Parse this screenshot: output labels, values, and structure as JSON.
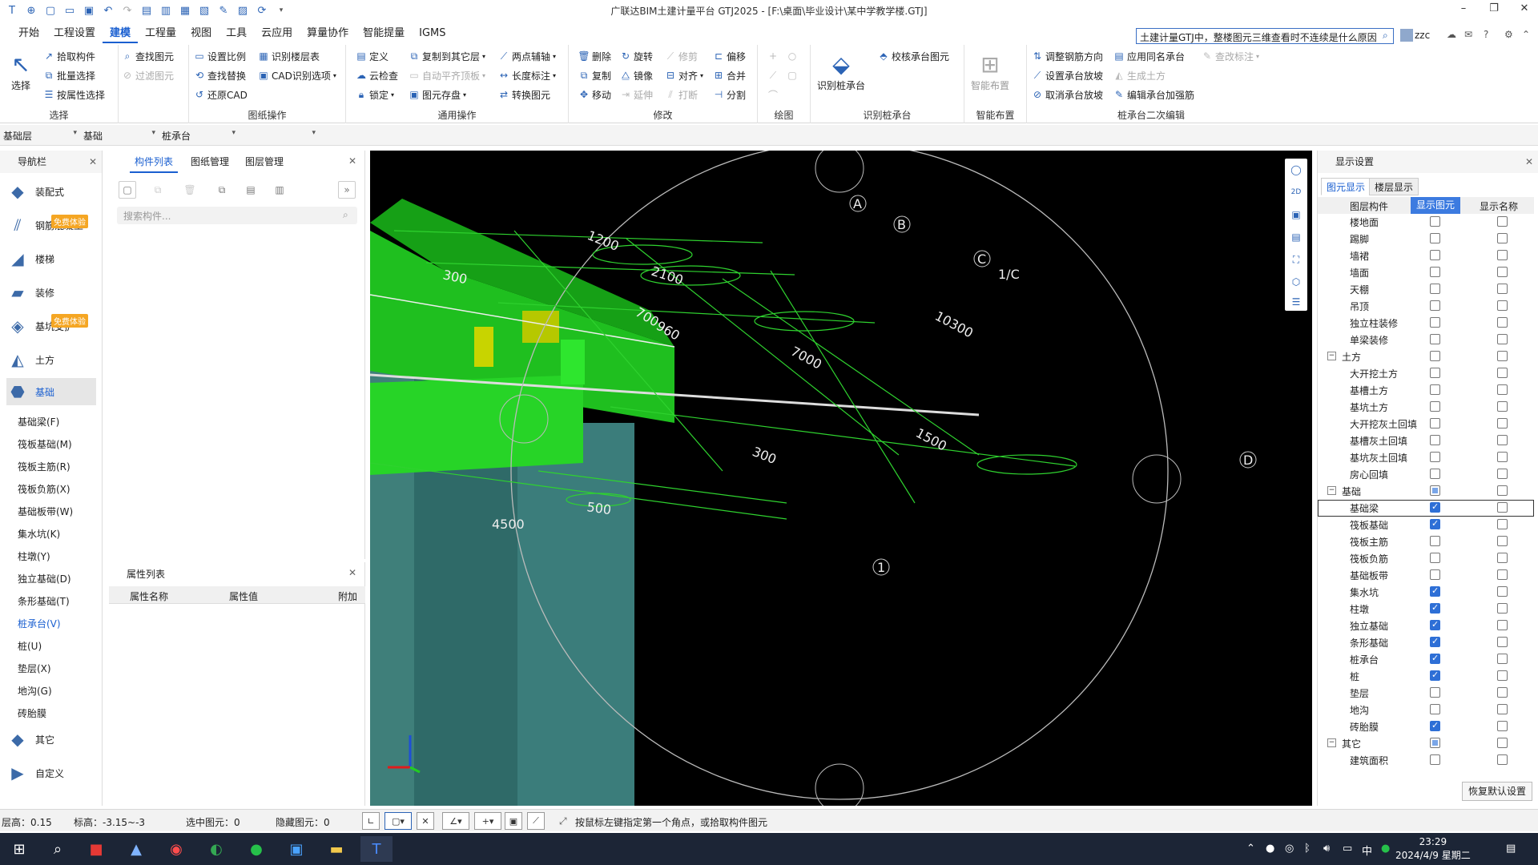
{
  "window": {
    "title": "广联达BIM土建计量平台 GTJ2025 - [F:\\桌面\\毕业设计\\某中学教学楼.GTJ]"
  },
  "menu": {
    "tabs": [
      "开始",
      "工程设置",
      "建模",
      "工程量",
      "视图",
      "工具",
      "云应用",
      "算量协作",
      "智能提量",
      "IGMS"
    ],
    "active": "建模",
    "search_value": "土建计量GTJ中，整楼图元三维查看时不连续是什么原因",
    "user": "zzc"
  },
  "ribbon": {
    "select": {
      "big": "选择",
      "b1": "拾取构件",
      "b2": "批量选择",
      "b3": "按属性选择",
      "b4": "查找图元",
      "b5": "过滤图元",
      "label": "选择"
    },
    "drawing": {
      "b1": "设置比例",
      "b2": "识别楼层表",
      "b3": "查找替换",
      "b4": "CAD识别选项",
      "b5": "还原CAD",
      "label": "图纸操作"
    },
    "common": {
      "b1": "定义",
      "b2": "复制到其它层",
      "b3": "云检查",
      "b4": "自动平齐顶板",
      "b5": "锁定",
      "b6": "图元存盘",
      "label": "通用操作"
    },
    "common2": {
      "b1": "两点辅轴",
      "b2": "长度标注",
      "b3": "转换图元"
    },
    "modify": {
      "b1": "删除",
      "b2": "旋转",
      "b3": "修剪",
      "b4": "偏移",
      "b5": "复制",
      "b6": "镜像",
      "b7": "对齐",
      "b8": "合并",
      "b9": "移动",
      "b10": "延伸",
      "b11": "打断",
      "b12": "分割",
      "label": "修改"
    },
    "draw": {
      "label": "绘图"
    },
    "pilecap": {
      "big": "识别桩承台",
      "b1": "校核承台图元",
      "label": "识别桩承台"
    },
    "smart": {
      "big": "智能布置",
      "label": "智能布置"
    },
    "edit2": {
      "b1": "调整钢筋方向",
      "b2": "应用同名承台",
      "b3": "查改标注",
      "b4": "设置承台放坡",
      "b5": "生成土方",
      "b6": "取消承台放坡",
      "b7": "编辑承台加强筋",
      "label": "桩承台二次编辑"
    }
  },
  "layerbar": {
    "floor": "基础层",
    "category": "基础",
    "type": "桩承台",
    "blank": ""
  },
  "nav": {
    "title": "导航栏",
    "big_items": [
      "装配式",
      "钢筋混凝土",
      "楼梯",
      "装修",
      "基坑支护",
      "土方",
      "基础",
      "其它",
      "自定义"
    ],
    "badge": "免费体验",
    "sub_items": [
      "基础梁(F)",
      "筏板基础(M)",
      "筏板主筋(R)",
      "筏板负筋(X)",
      "基础板带(W)",
      "集水坑(K)",
      "柱墩(Y)",
      "独立基础(D)",
      "条形基础(T)",
      "桩承台(V)",
      "桩(U)",
      "垫层(X)",
      "地沟(G)",
      "砖胎膜"
    ],
    "selected_sub": "桩承台(V)"
  },
  "comp": {
    "tabs": [
      "构件列表",
      "图纸管理",
      "图层管理"
    ],
    "search_placeholder": "搜索构件..."
  },
  "props": {
    "title": "属性列表",
    "cols": [
      "属性名称",
      "属性值",
      "附加"
    ]
  },
  "viewport": {
    "axis_labels": [
      "A",
      "B",
      "C",
      "1/C",
      "D",
      "1"
    ],
    "dims": [
      "1200",
      "2100",
      "700",
      "960",
      "10300",
      "7000",
      "1500",
      "4500",
      "300",
      "500"
    ]
  },
  "display": {
    "title": "显示设置",
    "tabs": [
      "图元显示",
      "楼层显示"
    ],
    "cols": [
      "图层构件",
      "显示图元",
      "显示名称"
    ],
    "rows": [
      {
        "name": "楼地面",
        "grp": false,
        "show": "off",
        "name_show": "off"
      },
      {
        "name": "踢脚",
        "grp": false,
        "show": "off",
        "name_show": "off"
      },
      {
        "name": "墙裙",
        "grp": false,
        "show": "off",
        "name_show": "off"
      },
      {
        "name": "墙面",
        "grp": false,
        "show": "off",
        "name_show": "off"
      },
      {
        "name": "天棚",
        "grp": false,
        "show": "off",
        "name_show": "off"
      },
      {
        "name": "吊顶",
        "grp": false,
        "show": "off",
        "name_show": "off"
      },
      {
        "name": "独立柱装修",
        "grp": false,
        "show": "off",
        "name_show": "off"
      },
      {
        "name": "单梁装修",
        "grp": false,
        "show": "off",
        "name_show": "off"
      },
      {
        "name": "土方",
        "grp": true,
        "show": "off",
        "name_show": "off"
      },
      {
        "name": "大开挖土方",
        "grp": false,
        "show": "off",
        "name_show": "off"
      },
      {
        "name": "基槽土方",
        "grp": false,
        "show": "off",
        "name_show": "off"
      },
      {
        "name": "基坑土方",
        "grp": false,
        "show": "off",
        "name_show": "off"
      },
      {
        "name": "大开挖灰土回填",
        "grp": false,
        "show": "off",
        "name_show": "off"
      },
      {
        "name": "基槽灰土回填",
        "grp": false,
        "show": "off",
        "name_show": "off"
      },
      {
        "name": "基坑灰土回填",
        "grp": false,
        "show": "off",
        "name_show": "off"
      },
      {
        "name": "房心回填",
        "grp": false,
        "show": "off",
        "name_show": "off"
      },
      {
        "name": "基础",
        "grp": true,
        "show": "part",
        "name_show": "off"
      },
      {
        "name": "基础梁",
        "grp": false,
        "show": "on",
        "name_show": "off"
      },
      {
        "name": "筏板基础",
        "grp": false,
        "show": "on",
        "name_show": "off"
      },
      {
        "name": "筏板主筋",
        "grp": false,
        "show": "off",
        "name_show": "off"
      },
      {
        "name": "筏板负筋",
        "grp": false,
        "show": "off",
        "name_show": "off"
      },
      {
        "name": "基础板带",
        "grp": false,
        "show": "off",
        "name_show": "off"
      },
      {
        "name": "集水坑",
        "grp": false,
        "show": "on",
        "name_show": "off"
      },
      {
        "name": "柱墩",
        "grp": false,
        "show": "on",
        "name_show": "off"
      },
      {
        "name": "独立基础",
        "grp": false,
        "show": "on",
        "name_show": "off"
      },
      {
        "name": "条形基础",
        "grp": false,
        "show": "on",
        "name_show": "off"
      },
      {
        "name": "桩承台",
        "grp": false,
        "show": "on",
        "name_show": "off"
      },
      {
        "name": "桩",
        "grp": false,
        "show": "on",
        "name_show": "off"
      },
      {
        "name": "垫层",
        "grp": false,
        "show": "off",
        "name_show": "off"
      },
      {
        "name": "地沟",
        "grp": false,
        "show": "off",
        "name_show": "off"
      },
      {
        "name": "砖胎膜",
        "grp": false,
        "show": "on",
        "name_show": "off"
      },
      {
        "name": "其它",
        "grp": true,
        "show": "part",
        "name_show": "off"
      },
      {
        "name": "建筑面积",
        "grp": false,
        "show": "off",
        "name_show": "off"
      }
    ],
    "restore": "恢复默认设置"
  },
  "status": {
    "floor_height": "层高：0.15",
    "elevation": "标高：-3.15~-3",
    "selected": "选中图元：0",
    "hidden": "隐藏图元：0",
    "hint": "按鼠标左键指定第一个角点，或拾取构件图元"
  },
  "taskbar": {
    "time": "23:29",
    "date": "2024/4/9 星期二",
    "ime": "中"
  }
}
